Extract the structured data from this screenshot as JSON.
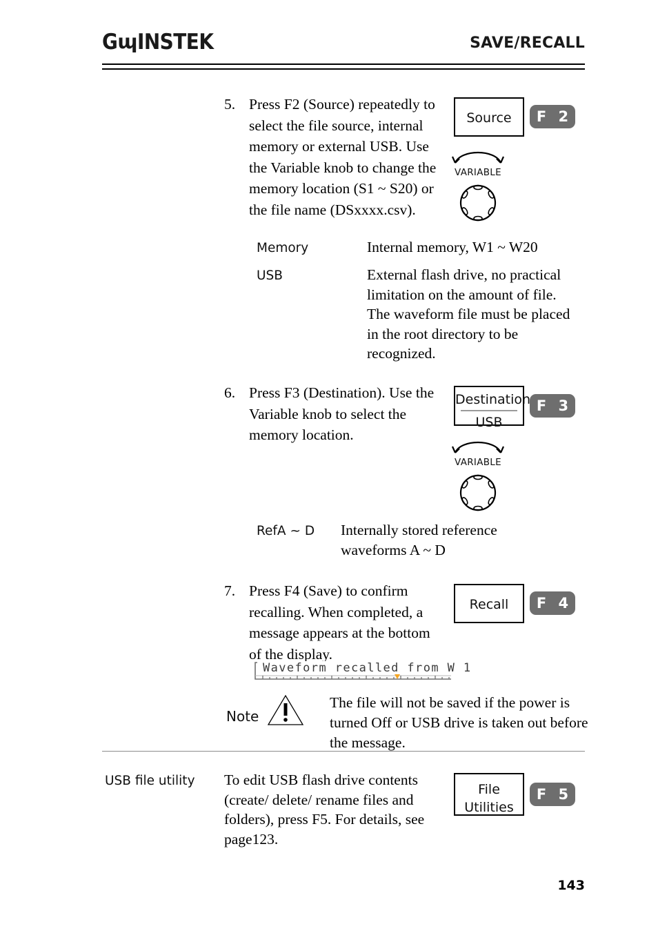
{
  "header": {
    "logo_g": "G",
    "logo_u": "ɰ",
    "logo_rest": "INSTEK",
    "title": "SAVE/RECALL"
  },
  "steps": [
    {
      "number": "5.",
      "text": "Press F2 (Source) repeatedly to select the file source, internal memory or external USB. Use the Variable knob to change the memory location (S1 ~ S20) or the file name (DSxxxx.csv).",
      "keybox": {
        "line1": "Source",
        "line2": "",
        "divider": false
      },
      "fkey": "F 2",
      "knob_label": "VARIABLE"
    },
    {
      "number": "6.",
      "text": "Press F3 (Destination). Use the Variable knob to select the memory location.",
      "keybox": {
        "line1": "Destination",
        "line2": "USB",
        "divider": true
      },
      "fkey": "F 3",
      "knob_label": "VARIABLE"
    },
    {
      "number": "7.",
      "text": "Press F4 (Save) to confirm recalling. When completed, a message appears at the bottom of the display.",
      "keybox": {
        "line1": "Recall",
        "line2": "",
        "divider": false
      },
      "fkey": "F 4",
      "knob_label": ""
    }
  ],
  "definitions": [
    {
      "term": "Memory",
      "desc": "Internal memory, W1 ~ W20"
    },
    {
      "term": "USB",
      "desc": "External flash drive, no practical limitation on the amount of file. The waveform file must be placed in the root directory to be recognized."
    },
    {
      "term": "RefA ~ D",
      "desc": "Internally stored reference waveforms A ~ D"
    }
  ],
  "message_strip": {
    "text": "Waveform recalled from W 1",
    "marker_color": "#f5a623"
  },
  "note": {
    "label": "Note",
    "icon": "warning-triangle-icon",
    "text": "The file will not be saved if the power is turned Off or USB drive is taken out before the message."
  },
  "usb_file_utility": {
    "term": "USB file utility",
    "desc": "To edit USB flash drive contents (create/ delete/ rename files and folders), press F5. For details, see page123.",
    "keybox": {
      "line1": "File",
      "line2": "Utilities",
      "divider": false
    },
    "fkey": "F 5"
  },
  "footer": {
    "page_number": "143"
  },
  "colors": {
    "fkey_bg": "#6e6e6e",
    "rule": "#8c8c8c",
    "marker": "#f5a623"
  }
}
